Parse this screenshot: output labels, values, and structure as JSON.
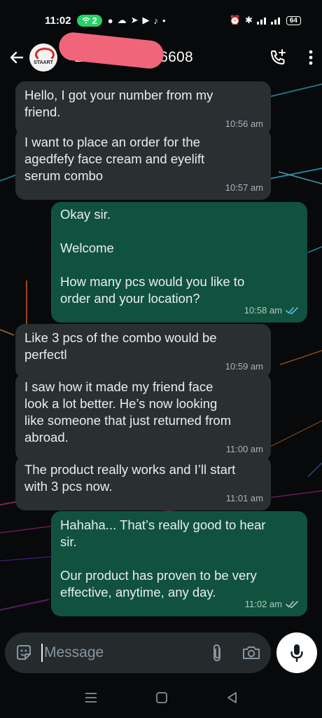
{
  "status_bar": {
    "time": "11:02",
    "hotspot_count": "2",
    "battery": "64"
  },
  "header": {
    "avatar_label": "STAART",
    "contact_name": "+23           64 6608"
  },
  "messages": [
    {
      "text": "Hello, I got your number from my\nfriend.",
      "time": "10:56 am",
      "direction": "incoming"
    },
    {
      "text": "I want to place an order for the\nagedfefy face cream and eyelift\nserum combo",
      "time": "10:57 am",
      "direction": "incoming"
    },
    {
      "text": "Okay sir.\n\nWelcome\n\nHow many pcs would you like to\norder and your location?",
      "time": "10:58 am",
      "direction": "outgoing",
      "status": "read"
    },
    {
      "text": "Like 3 pcs of the combo would be\nperfectl",
      "time": "10:59 am",
      "direction": "incoming"
    },
    {
      "text": "I saw  how it made my friend face\nlook a lot better. He’s now looking\nlike someone that just returned from\nabroad.",
      "time": "11:00 am",
      "direction": "incoming"
    },
    {
      "text": "The product really works and I’ll start\nwith 3 pcs now.",
      "time": "11:01 am",
      "direction": "incoming"
    },
    {
      "text": "Hahaha... That’s really good to hear\nsir.\n\nOur product has proven to be very\neffective, anytime, any day.",
      "time": "11:02 am",
      "direction": "outgoing",
      "status": "delivered"
    }
  ],
  "composer": {
    "placeholder": "Message"
  },
  "colors": {
    "incoming_bubble": "#2a2f32",
    "outgoing_bubble": "#11523e",
    "read_ticks": "#53bdeb",
    "delivered_ticks": "#b1c9c0"
  }
}
